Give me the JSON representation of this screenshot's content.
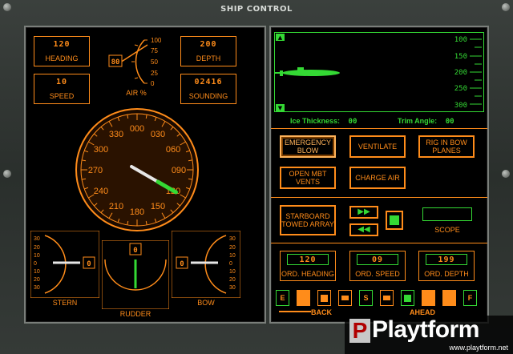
{
  "window": {
    "title": "SHIP CONTROL"
  },
  "left": {
    "heading": {
      "value": "120",
      "label": "HEADING"
    },
    "speed": {
      "value": "10",
      "label": "SPEED"
    },
    "air": {
      "value": "80",
      "label": "AIR %",
      "ticks": [
        "100",
        "75",
        "50",
        "25",
        "0"
      ]
    },
    "depth": {
      "value": "200",
      "label": "DEPTH"
    },
    "sounding": {
      "value": "02416",
      "label": "SOUNDING"
    },
    "compass": {
      "labels": [
        "000",
        "030",
        "060",
        "090",
        "120",
        "150",
        "180",
        "210",
        "240",
        "270",
        "300",
        "330"
      ],
      "heading_deg": 120
    },
    "stern": {
      "value": "0",
      "label": "STERN",
      "ticks": [
        "30",
        "20",
        "10",
        "0",
        "10",
        "20",
        "30"
      ]
    },
    "rudder": {
      "value": "0",
      "label": "RUDDER"
    },
    "bow": {
      "value": "0",
      "label": "BOW",
      "ticks": [
        "30",
        "20",
        "10",
        "0",
        "10",
        "20",
        "30"
      ]
    }
  },
  "right": {
    "depth_scale": [
      "100",
      "150",
      "200",
      "250",
      "300"
    ],
    "ice_thickness": {
      "label": "Ice Thickness:",
      "value": "00"
    },
    "trim_angle": {
      "label": "Trim Angle:",
      "value": "00"
    },
    "buttons": {
      "emergency_blow": "EMERGENCY BLOW",
      "ventilate": "VENTILATE",
      "rig_in": "RIG IN BOW PLANES",
      "open_mbt": "OPEN MBT VENTS",
      "charge_air": "CHARGE AIR",
      "starboard_array": "STARBOARD TOWED ARRAY"
    },
    "scope_label": "SCOPE",
    "ordered": {
      "heading": {
        "value": "120",
        "label": "ORD. HEADING"
      },
      "speed": {
        "value": "09",
        "label": "ORD. SPEED"
      },
      "depth": {
        "value": "199",
        "label": "ORD. DEPTH"
      }
    },
    "bottom_buttons": [
      "E",
      "",
      "",
      "",
      "S",
      "",
      "",
      "",
      "",
      "F"
    ],
    "back_label": "BACK",
    "ahead_label": "AHEAD"
  },
  "watermark": {
    "text": "Playtform",
    "url": "www.playtform.net"
  },
  "colors": {
    "orange": "#ff8c1a",
    "green": "#34d934",
    "needle": "#e6e6e6"
  }
}
